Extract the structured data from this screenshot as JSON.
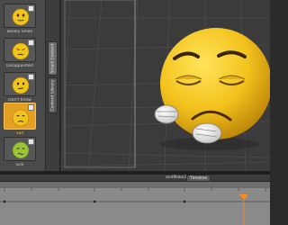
{
  "assets": {
    "items": [
      {
        "label": "Barely Smile",
        "color": "#f0c419",
        "selected": false
      },
      {
        "label": "Disappointed",
        "color": "#f0c419",
        "selected": false
      },
      {
        "label": "Don't Know",
        "color": "#f0c419",
        "selected": false
      },
      {
        "label": "Sad",
        "color": "#f0c419",
        "selected": true
      },
      {
        "label": "Sick",
        "color": "#9bc43c",
        "selected": false
      }
    ]
  },
  "tabs": {
    "smart_content": "Smart Content",
    "content_library": "Content Library"
  },
  "timeline": {
    "scene_name": "andMako2",
    "tab_label": "Timeline",
    "playhead_color": "#ff8c1a"
  },
  "colors": {
    "emoticon_yellow": "#f3c21c",
    "selected_accent": "#e3a022",
    "viewport_bg": "#3b3b3b"
  }
}
